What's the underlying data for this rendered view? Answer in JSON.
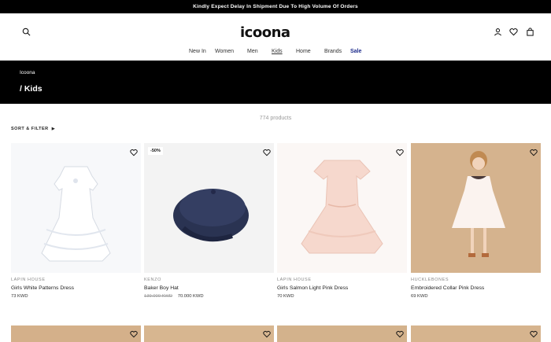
{
  "announcement": "Kindly Expect Delay In Shipment Due To High Volume Of Orders",
  "brand_logo": "icoona",
  "nav": {
    "items": [
      {
        "label": "New In"
      },
      {
        "label": "Women"
      },
      {
        "label": "Men"
      },
      {
        "label": "Kids"
      },
      {
        "label": "Home"
      },
      {
        "label": "Brands"
      },
      {
        "label": "Sale"
      }
    ]
  },
  "banner": {
    "breadcrumb": "Icoona",
    "title": "/ Kids"
  },
  "listing": {
    "count": "774 products",
    "filter_label": "SORT & FILTER"
  },
  "products": [
    {
      "brand": "LAPIN HOUSE",
      "name": "Girls White Patterns Dress",
      "price": "73 KWD",
      "old_price": "",
      "badge": ""
    },
    {
      "brand": "KENZO",
      "name": "Baker Boy Hat",
      "price": "70.000 KWD",
      "old_price": "139.000 KWD",
      "badge": "-50%"
    },
    {
      "brand": "LAPIN HOUSE",
      "name": "Girls Salmon Light Pink Dress",
      "price": "70 KWD",
      "old_price": "",
      "badge": ""
    },
    {
      "brand": "HUCKLEBONES",
      "name": "Embroidered Collar Pink Dress",
      "price": "69 KWD",
      "old_price": "",
      "badge": ""
    }
  ],
  "colors": {
    "accent_sale": "#1b2a8a",
    "banner_bg": "#000000"
  }
}
